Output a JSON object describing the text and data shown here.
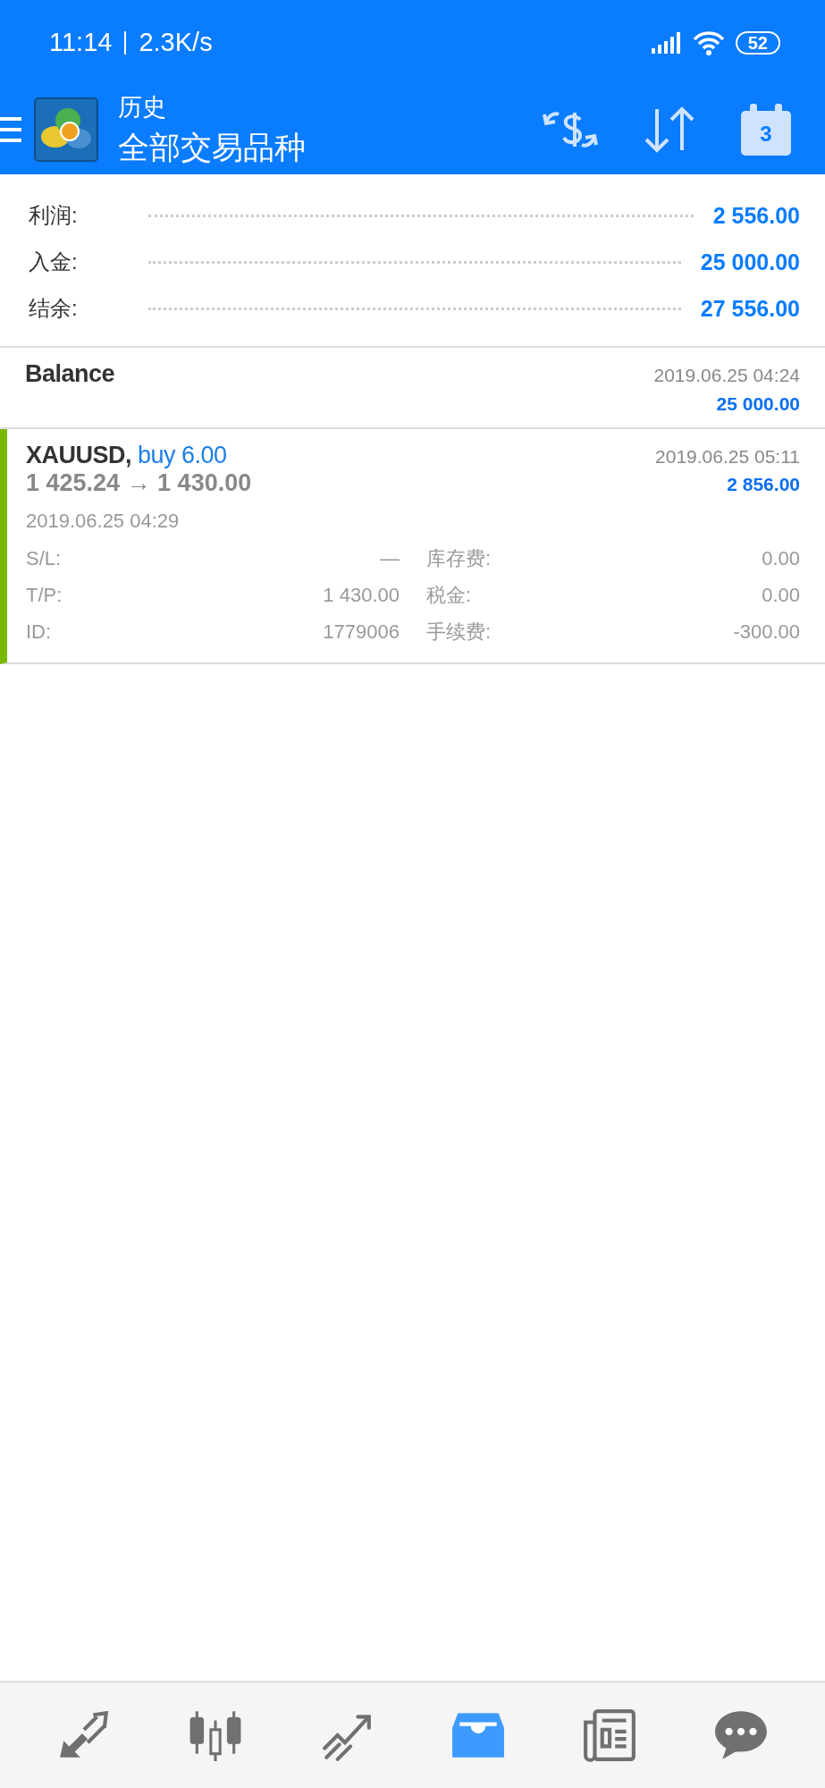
{
  "status_bar": {
    "time": "11:14",
    "speed": "2.3K/s",
    "battery": "52"
  },
  "header": {
    "title": "历史",
    "subtitle": "全部交易品种",
    "calendar_day": "3"
  },
  "summary": [
    {
      "label": "利润:",
      "value": "2 556.00"
    },
    {
      "label": "入金:",
      "value": "25 000.00"
    },
    {
      "label": "结余:",
      "value": "27 556.00"
    }
  ],
  "deals": [
    {
      "kind": "balance",
      "title": "Balance",
      "time": "2019.06.25 04:24",
      "amount": "25 000.00"
    },
    {
      "kind": "trade",
      "symbol": "XAUUSD,",
      "side": "buy 6.00",
      "prices": "1 425.24 → 1 430.00",
      "time": "2019.06.25 05:11",
      "amount": "2 856.00",
      "open_time": "2019.06.25 04:29",
      "details": [
        {
          "label": "S/L:",
          "value": "—",
          "label_2": "库存费:",
          "value_2": "0.00"
        },
        {
          "label": "T/P:",
          "value": "1 430.00",
          "label_2": "税金:",
          "value_2": "0.00"
        },
        {
          "label": "ID:",
          "value": "1779006",
          "label_2": "手续费:",
          "value_2": "-300.00"
        }
      ]
    }
  ],
  "bottom_nav": [
    {
      "kind": "trade",
      "selected": false
    },
    {
      "kind": "quotes",
      "selected": false
    },
    {
      "kind": "chart",
      "selected": false
    },
    {
      "kind": "history",
      "selected": true
    },
    {
      "kind": "news",
      "selected": false
    },
    {
      "kind": "chat",
      "selected": false
    }
  ]
}
